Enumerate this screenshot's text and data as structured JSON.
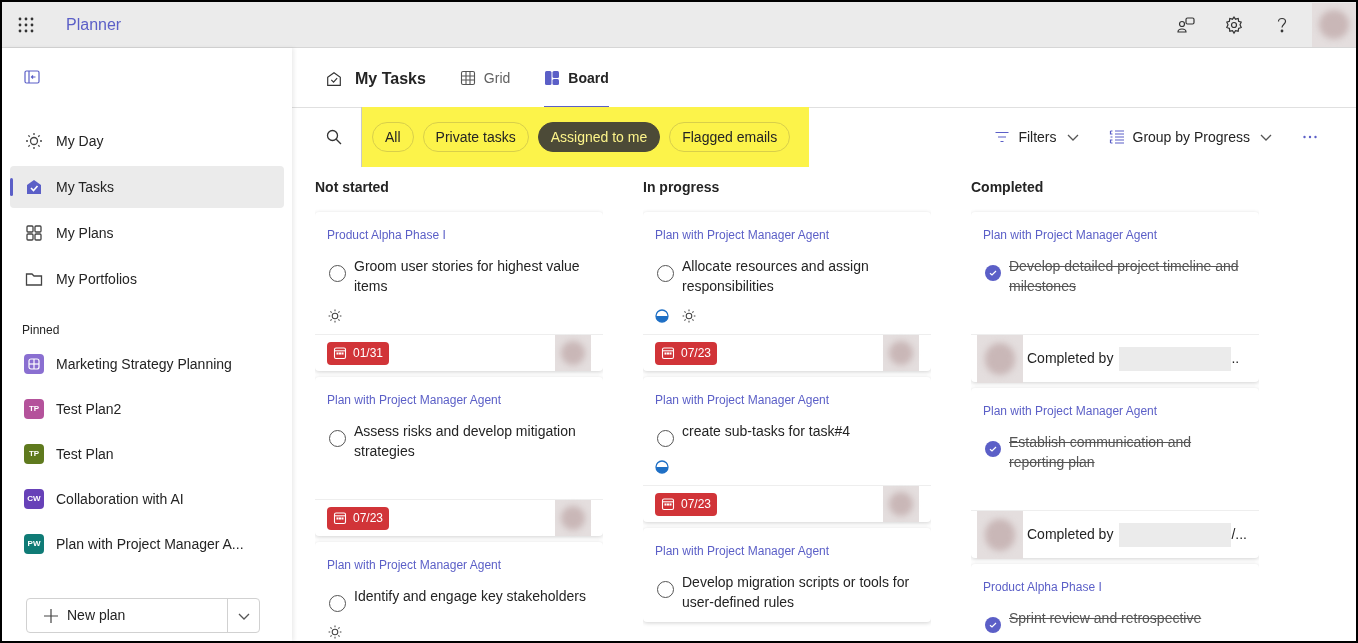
{
  "app_bar": {
    "title": "Planner"
  },
  "sidebar": {
    "nav": [
      {
        "label": "My Day",
        "selected": false
      },
      {
        "label": "My Tasks",
        "selected": true
      },
      {
        "label": "My Plans",
        "selected": false
      },
      {
        "label": "My Portfolios",
        "selected": false
      }
    ],
    "pinned_heading": "Pinned",
    "pinned": [
      {
        "label": "Marketing Strategy Planning",
        "kind": "icon",
        "color": "#8a6fd1"
      },
      {
        "label": "Test Plan2",
        "kind": "initials",
        "initials": "TP",
        "color": "#b4529b"
      },
      {
        "label": "Test Plan",
        "kind": "initials",
        "initials": "TP",
        "color": "#5f7a1e"
      },
      {
        "label": "Collaboration with AI",
        "kind": "initials",
        "initials": "CW",
        "color": "#6741b8"
      },
      {
        "label": "Plan with Project Manager A...",
        "kind": "initials",
        "initials": "PW",
        "color": "#0f7b76"
      }
    ],
    "new_plan": "New plan"
  },
  "header": {
    "title": "My Tasks",
    "tabs": [
      {
        "label": "Grid",
        "selected": false
      },
      {
        "label": "Board",
        "selected": true
      }
    ]
  },
  "toolbar": {
    "chips": [
      {
        "label": "All",
        "selected": false
      },
      {
        "label": "Private tasks",
        "selected": false
      },
      {
        "label": "Assigned to me",
        "selected": true
      },
      {
        "label": "Flagged emails",
        "selected": false
      }
    ],
    "filters": "Filters",
    "group_by": "Group by Progress"
  },
  "columns": [
    {
      "title": "Not started",
      "cards": [
        {
          "plan": "Product Alpha Phase I",
          "title": "Groom user stories for highest value items",
          "completed": false,
          "in_progress": false,
          "my_day": true,
          "due": "01/31"
        },
        {
          "plan": "Plan with Project Manager Agent",
          "title": "Assess risks and develop mitigation strategies",
          "completed": false,
          "in_progress": false,
          "my_day": false,
          "due": "07/23"
        },
        {
          "plan": "Plan with Project Manager Agent",
          "title": "Identify and engage key stakeholders",
          "completed": false,
          "in_progress": false,
          "my_day": true
        }
      ]
    },
    {
      "title": "In progress",
      "cards": [
        {
          "plan": "Plan with Project Manager Agent",
          "title": "Allocate resources and assign responsibilities",
          "completed": false,
          "in_progress": true,
          "my_day": true,
          "due": "07/23"
        },
        {
          "plan": "Plan with Project Manager Agent",
          "title": "create sub-tasks for task#4",
          "completed": false,
          "in_progress": true,
          "my_day": false,
          "due": "07/23"
        },
        {
          "plan": "Plan with Project Manager Agent",
          "title": "Develop migration scripts or tools for user-defined rules",
          "completed": false,
          "in_progress": false,
          "my_day": false
        }
      ]
    },
    {
      "title": "Completed",
      "cards": [
        {
          "plan": "Plan with Project Manager Agent",
          "title": "Develop detailed project timeline and milestones",
          "completed": true,
          "in_progress": false,
          "my_day": false,
          "completed_by": "Completed by",
          "name_tail": ".."
        },
        {
          "plan": "Plan with Project Manager Agent",
          "title": "Establish communication and reporting plan",
          "completed": true,
          "in_progress": false,
          "my_day": false,
          "completed_by": "Completed by",
          "name_tail": "/..."
        },
        {
          "plan": "Product Alpha Phase I",
          "title": "Sprint review and retrospective",
          "completed": true,
          "in_progress": false,
          "my_day": false
        }
      ]
    }
  ]
}
